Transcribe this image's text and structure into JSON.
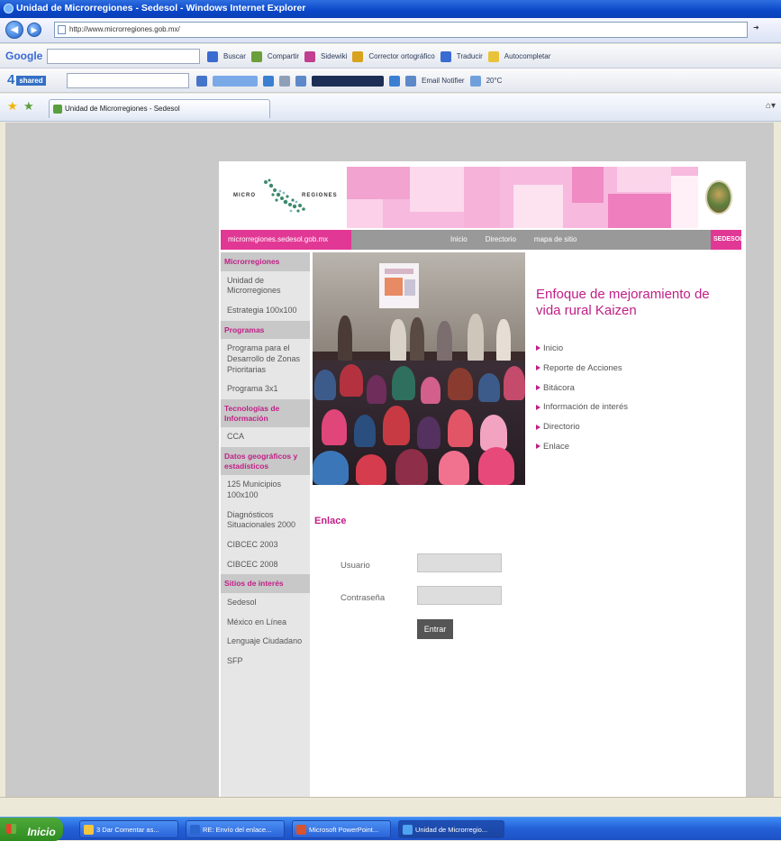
{
  "window": {
    "title": "Unidad de Microrregiones - Sedesol - Windows Internet Explorer"
  },
  "browser": {
    "address": "http://www.microrregiones.gob.mx/",
    "tab_label": "Unidad de Microrregiones - Sedesol",
    "google_label": "Google",
    "four_label": "4",
    "toolbar1": [
      "Buscar",
      "Compartir",
      "Sidewiki",
      "Corrector ortográfico",
      "Traducir",
      "Autocompletar"
    ],
    "toolbar2": [
      "Email Notifier",
      "20°C"
    ]
  },
  "site": {
    "logo_micro": "MICRO",
    "logo_regiones": "REGIONES",
    "domain": "microrregiones.sedesol.gob.mx",
    "nav_links": [
      "Inicio",
      "Directorio",
      "mapa de sitio"
    ],
    "brand": "SEDESOL"
  },
  "sidebar": [
    {
      "type": "header",
      "label": "Microrregiones"
    },
    {
      "type": "item",
      "label": "Unidad de Microrregiones"
    },
    {
      "type": "item",
      "label": "Estrategia 100x100"
    },
    {
      "type": "header",
      "label": "Programas"
    },
    {
      "type": "item",
      "label": "Programa para el Desarrollo de Zonas Prioritarias"
    },
    {
      "type": "item",
      "label": "Programa 3x1"
    },
    {
      "type": "header",
      "label": "Tecnologías de Información"
    },
    {
      "type": "item",
      "label": "CCA"
    },
    {
      "type": "header",
      "label": "Datos geográficos y estadísticos"
    },
    {
      "type": "item",
      "label": "125 Municipios 100x100"
    },
    {
      "type": "item",
      "label": "Diagnósticos Situacionales 2000"
    },
    {
      "type": "item",
      "label": "CIBCEC 2003"
    },
    {
      "type": "item",
      "label": "CIBCEC 2008"
    },
    {
      "type": "header",
      "label": "Sitios de interés"
    },
    {
      "type": "item",
      "label": "Sedesol"
    },
    {
      "type": "item",
      "label": "México en Línea"
    },
    {
      "type": "item",
      "label": "Lenguaje Ciudadano"
    },
    {
      "type": "item",
      "label": "SFP"
    }
  ],
  "feature": {
    "title": "Enfoque de mejoramiento de vida rural Kaizen",
    "links": [
      "Inicio",
      "Reporte de Acciones",
      "Bitácora",
      "Información de interés",
      "Directorio",
      "Enlace"
    ]
  },
  "login": {
    "section_title": "Enlace",
    "user_label": "Usuario",
    "password_label": "Contraseña",
    "user_value": "",
    "password_value": "",
    "submit_label": "Entrar"
  },
  "taskbar": {
    "start_label": "Inicio",
    "tasks": [
      "3 Dar Comentar as...",
      "RE: Envío del enlace...",
      "Microsoft PowerPoint...",
      "Unidad de Microrregio..."
    ]
  },
  "colors": {
    "accent_pink": "#e23895",
    "heading_magenta": "#c01f86",
    "nav_gray": "#999999",
    "sidebar_bg": "#e6e6e6"
  }
}
